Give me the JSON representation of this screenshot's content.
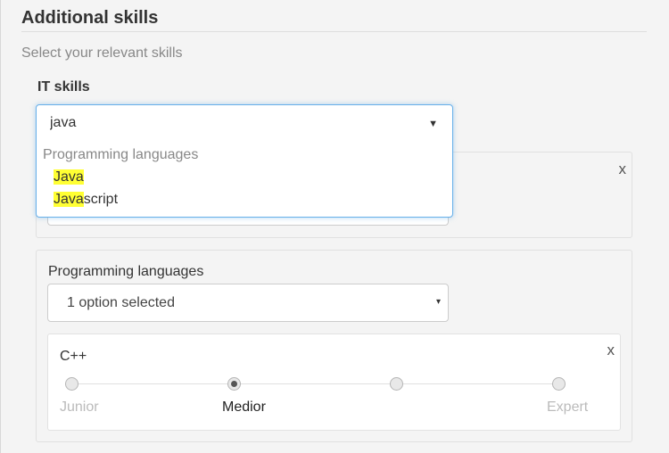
{
  "section": {
    "title": "Additional skills",
    "subtitle": "Select your relevant skills",
    "field_label": "IT skills"
  },
  "search": {
    "value": "java",
    "caret": "▼"
  },
  "dropdown": {
    "group_label": "Programming languages",
    "options": [
      {
        "match": "Java",
        "rest": ""
      },
      {
        "match": "Java",
        "rest": "script"
      }
    ]
  },
  "panel1": {
    "close": "x"
  },
  "panel2": {
    "label": "Programming languages",
    "select_value": "1 option selected",
    "caret": "▾",
    "close": "x"
  },
  "skill": {
    "name": "C++",
    "close": "x",
    "levels": [
      "Junior",
      "Medior",
      "",
      "Expert"
    ],
    "selected_level": "Medior"
  }
}
